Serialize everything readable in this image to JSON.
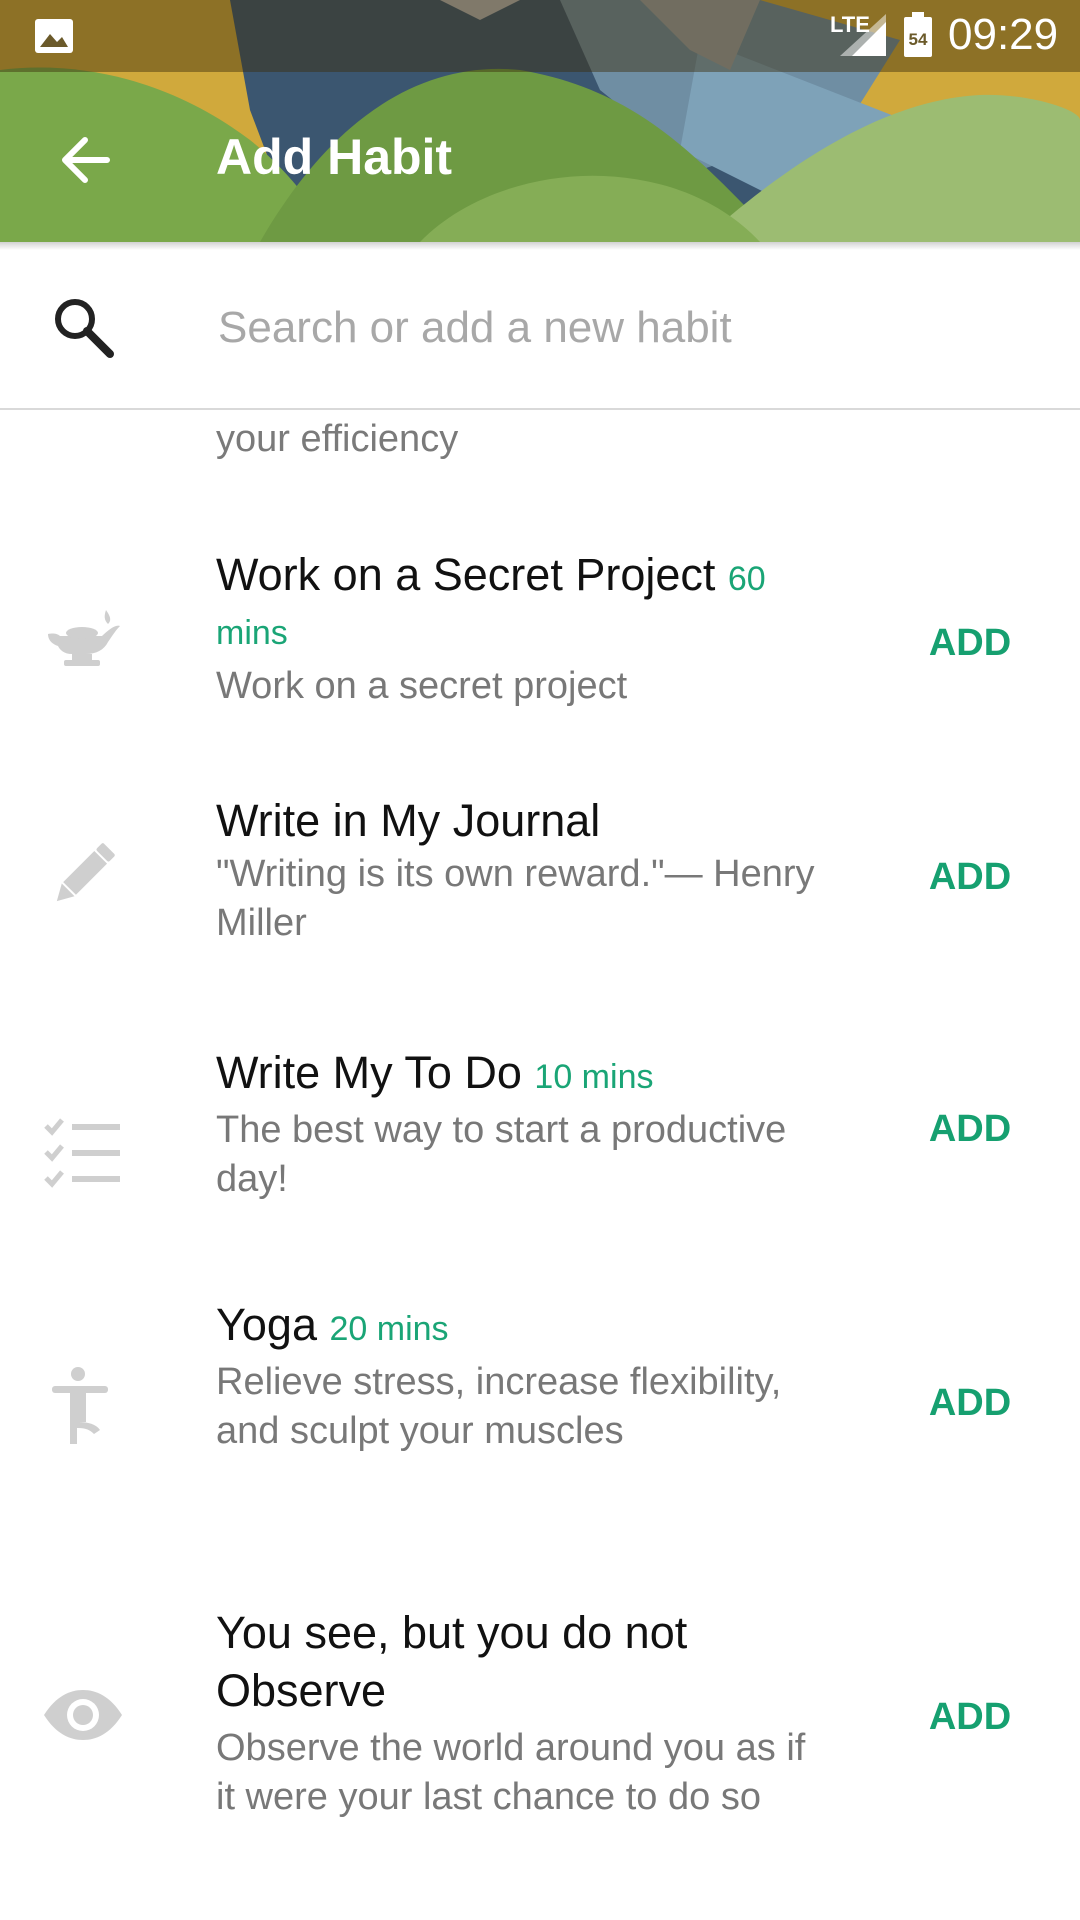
{
  "status_bar": {
    "network": "LTE",
    "battery_level": "54",
    "time": "09:29"
  },
  "toolbar": {
    "title": "Add Habit"
  },
  "search": {
    "placeholder": "Search or add a new habit"
  },
  "list": {
    "partial_description": "your efficiency",
    "items": [
      {
        "name": "Work on a Secret Project",
        "duration": "60 mins",
        "description": "Work on a secret project",
        "icon": "genie-lamp-icon",
        "action": "ADD"
      },
      {
        "name": "Write in My Journal",
        "duration": "",
        "description": "\"Writing is its own reward.\"— Henry Miller",
        "icon": "pencil-icon",
        "action": "ADD"
      },
      {
        "name": "Write My To Do",
        "duration": "10 mins",
        "description": "The best way to start a productive day!",
        "icon": "checklist-icon",
        "action": "ADD"
      },
      {
        "name": "Yoga",
        "duration": "20 mins",
        "description": "Relieve stress, increase flexibility, and sculpt your muscles",
        "icon": "yoga-icon",
        "action": "ADD"
      },
      {
        "name": "You see, but you do not Observe",
        "duration": "",
        "description": "Observe the world around you as if it were your last chance to do so",
        "icon": "eye-icon",
        "action": "ADD"
      }
    ]
  },
  "colors": {
    "accent": "#16a070",
    "header_green": "#7aa84a",
    "icon_gray": "#cfcfcf"
  }
}
